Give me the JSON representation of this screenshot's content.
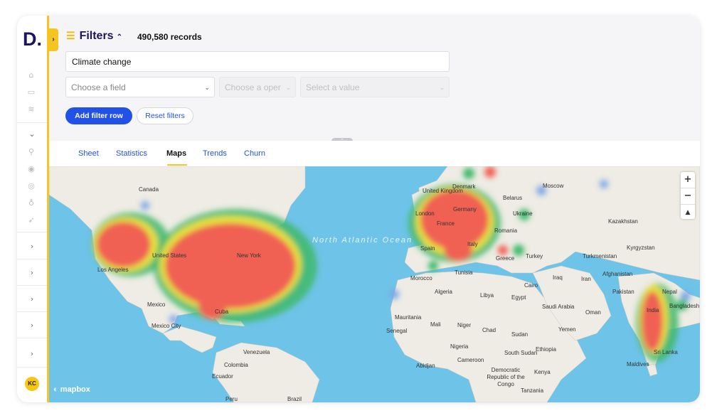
{
  "app": {
    "logo": "D.",
    "user_initials": "KC",
    "accent": "#f5c623",
    "primary": "#2251e8"
  },
  "filters": {
    "title": "Filters",
    "records": "490,580 records",
    "search_value": "Climate change",
    "field_placeholder": "Choose a field",
    "operator_placeholder": "Choose a oper",
    "value_placeholder": "Select a value",
    "add_button": "Add filter row",
    "reset_button": "Reset filters"
  },
  "tabs": [
    {
      "label": "Sheet"
    },
    {
      "label": "Statistics"
    },
    {
      "label": "Maps",
      "active": true
    },
    {
      "label": "Trends"
    },
    {
      "label": "Churn"
    }
  ],
  "map": {
    "attribution": "mapbox",
    "zoom_in": "+",
    "zoom_out": "−",
    "compass": "▲",
    "ocean_label": "North Atlantic Ocean",
    "labels": [
      "Canada",
      "United States",
      "Los Angeles",
      "New York",
      "Mexico",
      "Mexico City",
      "Cuba",
      "Venezuela",
      "Colombia",
      "Ecuador",
      "Brazil",
      "Peru",
      "United Kingdom",
      "London",
      "Denmark",
      "Belarus",
      "Germany",
      "France",
      "Ukraine",
      "Moscow",
      "Romania",
      "Spain",
      "Italy",
      "Greece",
      "Turkey",
      "Tunisia",
      "Morocco",
      "Algeria",
      "Libya",
      "Egypt",
      "Cairo",
      "Iraq",
      "Iran",
      "Saudi Arabia",
      "Oman",
      "Yemen",
      "Sudan",
      "Ethiopia",
      "South Sudan",
      "Kenya",
      "Mauritania",
      "Mali",
      "Niger",
      "Chad",
      "Senegal",
      "Nigeria",
      "Cameroon",
      "Abidjan",
      "Democratic Republic of the Congo",
      "Tanzania",
      "Kazakhstan",
      "Kyrgyzstan",
      "Turkmenistan",
      "Afghanistan",
      "Pakistan",
      "Nepal",
      "India",
      "Bangladesh",
      "Sri Lanka",
      "Maldives"
    ]
  }
}
